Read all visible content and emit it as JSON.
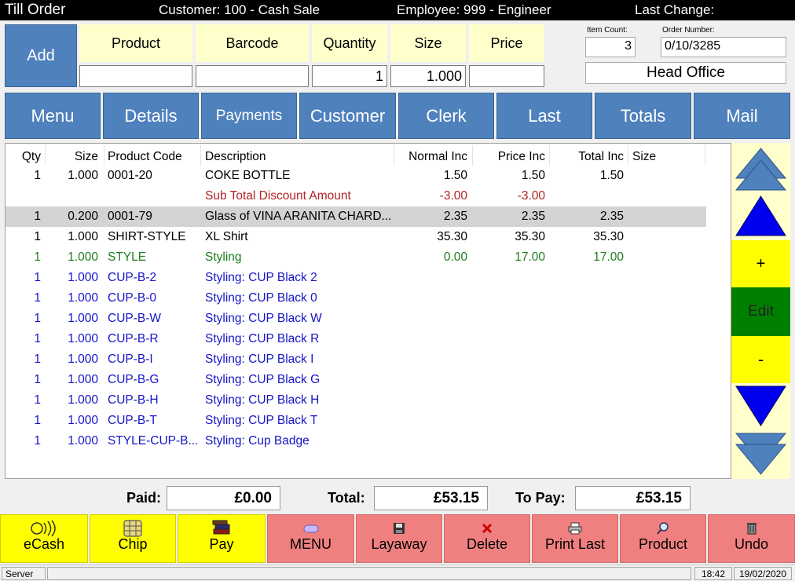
{
  "titlebar": {
    "title": "Till Order",
    "customer": "Customer: 100 - Cash Sale",
    "employee": "Employee: 999 - Engineer",
    "last_change": "Last Change:"
  },
  "entry": {
    "add_label": "Add",
    "product_label": "Product",
    "barcode_label": "Barcode",
    "quantity_label": "Quantity",
    "size_label": "Size",
    "price_label": "Price",
    "product_value": "",
    "barcode_value": "",
    "quantity_value": "1",
    "size_value": "1.000",
    "price_value": ""
  },
  "info": {
    "item_count_label": "Item Count:",
    "item_count": "3",
    "order_number_label": "Order Number:",
    "order_number": "0/10/3285",
    "location": "Head Office"
  },
  "tabs": [
    "Menu",
    "Details",
    "Payments",
    "Customer",
    "Clerk",
    "Last",
    "Totals",
    "Mail"
  ],
  "grid": {
    "headers": [
      "Qty",
      "Size",
      "Product Code",
      "Description",
      "Normal Inc",
      "Price Inc",
      "Total Inc",
      "Size"
    ],
    "rows": [
      {
        "qty": "1",
        "size": "1.000",
        "code": "0001-20",
        "desc": "COKE BOTTLE",
        "normal": "1.50",
        "price": "1.50",
        "total": "1.50",
        "style": "normal"
      },
      {
        "qty": "",
        "size": "",
        "code": "",
        "desc": "Sub Total Discount Amount",
        "normal": "-3.00",
        "price": "-3.00",
        "total": "",
        "style": "discount"
      },
      {
        "qty": "1",
        "size": "0.200",
        "code": "0001-79",
        "desc": "Glass of VINA ARANITA CHARD...",
        "normal": "2.35",
        "price": "2.35",
        "total": "2.35",
        "style": "selected"
      },
      {
        "qty": "1",
        "size": "1.000",
        "code": "SHIRT-STYLE",
        "desc": "XL Shirt",
        "normal": "35.30",
        "price": "35.30",
        "total": "35.30",
        "style": "normal"
      },
      {
        "qty": "1",
        "size": "1.000",
        "code": "STYLE",
        "desc": "Styling",
        "normal": "0.00",
        "price": "17.00",
        "total": "17.00",
        "style": "green"
      },
      {
        "qty": "1",
        "size": "1.000",
        "code": "CUP-B-2",
        "desc": "Styling: CUP Black 2",
        "normal": "",
        "price": "",
        "total": "",
        "style": "blue"
      },
      {
        "qty": "1",
        "size": "1.000",
        "code": "CUP-B-0",
        "desc": "Styling: CUP Black 0",
        "normal": "",
        "price": "",
        "total": "",
        "style": "blue"
      },
      {
        "qty": "1",
        "size": "1.000",
        "code": "CUP-B-W",
        "desc": "Styling: CUP Black W",
        "normal": "",
        "price": "",
        "total": "",
        "style": "blue"
      },
      {
        "qty": "1",
        "size": "1.000",
        "code": "CUP-B-R",
        "desc": "Styling: CUP Black R",
        "normal": "",
        "price": "",
        "total": "",
        "style": "blue"
      },
      {
        "qty": "1",
        "size": "1.000",
        "code": "CUP-B-I",
        "desc": "Styling: CUP Black I",
        "normal": "",
        "price": "",
        "total": "",
        "style": "blue"
      },
      {
        "qty": "1",
        "size": "1.000",
        "code": "CUP-B-G",
        "desc": "Styling: CUP Black G",
        "normal": "",
        "price": "",
        "total": "",
        "style": "blue"
      },
      {
        "qty": "1",
        "size": "1.000",
        "code": "CUP-B-H",
        "desc": "Styling: CUP Black H",
        "normal": "",
        "price": "",
        "total": "",
        "style": "blue"
      },
      {
        "qty": "1",
        "size": "1.000",
        "code": "CUP-B-T",
        "desc": "Styling: CUP Black T",
        "normal": "",
        "price": "",
        "total": "",
        "style": "blue"
      },
      {
        "qty": "1",
        "size": "1.000",
        "code": "STYLE-CUP-B...",
        "desc": "Styling: Cup Badge",
        "normal": "",
        "price": "",
        "total": "",
        "style": "blue"
      }
    ]
  },
  "side": {
    "plus_label": "+",
    "edit_label": "Edit",
    "minus_label": "-"
  },
  "totals": {
    "paid_label": "Paid:",
    "paid": "£0.00",
    "total_label": "Total:",
    "total": "£53.15",
    "topay_label": "To Pay:",
    "topay": "£53.15"
  },
  "buttons": [
    {
      "label": "eCash",
      "icon": "contactless-icon",
      "color": "yellow"
    },
    {
      "label": "Chip",
      "icon": "chip-card-icon",
      "color": "yellow"
    },
    {
      "label": "Pay",
      "icon": "books-icon",
      "color": "yellow"
    },
    {
      "label": "MENU",
      "icon": "menu-pill-icon",
      "color": "salmon"
    },
    {
      "label": "Layaway",
      "icon": "save-icon",
      "color": "salmon"
    },
    {
      "label": "Delete",
      "icon": "delete-x-icon",
      "color": "salmon"
    },
    {
      "label": "Print Last",
      "icon": "printer-icon",
      "color": "salmon"
    },
    {
      "label": "Product",
      "icon": "magnifier-icon",
      "color": "salmon"
    },
    {
      "label": "Undo",
      "icon": "trash-icon",
      "color": "salmon"
    }
  ],
  "status": {
    "left": "Server",
    "time": "18:42",
    "date": "19/02/2020"
  },
  "colors": {
    "blue_button": "#4f81bd",
    "yellow_header": "#ffffcc",
    "yellow_button": "#ffff00",
    "salmon_button": "#f08080",
    "edit_green": "#008000",
    "row_selected": "#d3d3d3",
    "text_discount": "#b22222",
    "text_green": "#1e7b1e",
    "text_blue": "#1515c8"
  }
}
